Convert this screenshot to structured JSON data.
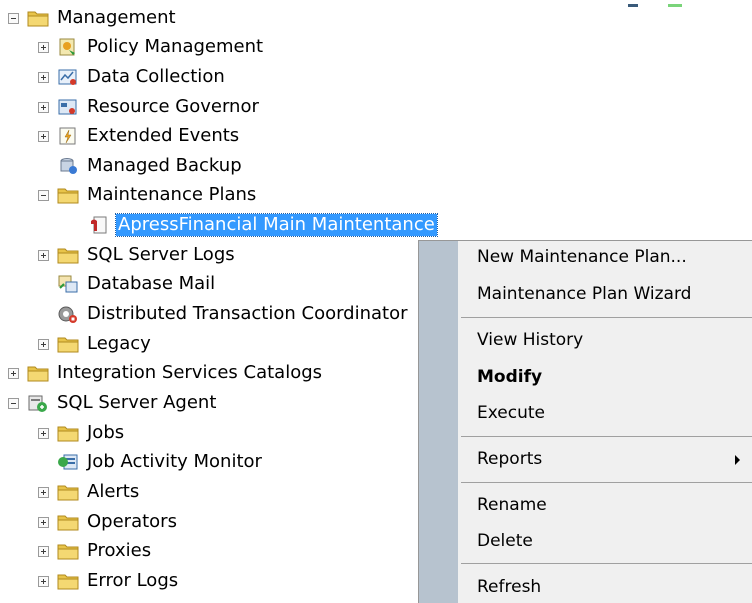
{
  "tree": {
    "management": "Management",
    "policy_management": "Policy Management",
    "data_collection": "Data Collection",
    "resource_governor": "Resource Governor",
    "extended_events": "Extended Events",
    "managed_backup": "Managed Backup",
    "maintenance_plans": "Maintenance Plans",
    "selected_plan": "ApressFinancial Main Maintentance",
    "sql_server_logs": "SQL Server Logs",
    "database_mail": "Database Mail",
    "dtc": "Distributed Transaction Coordinator",
    "legacy": "Legacy",
    "integration_services": "Integration Services Catalogs",
    "sql_server_agent": "SQL Server Agent",
    "jobs": "Jobs",
    "job_activity_monitor": "Job Activity Monitor",
    "alerts": "Alerts",
    "operators": "Operators",
    "proxies": "Proxies",
    "error_logs": "Error Logs"
  },
  "context_menu": {
    "new_plan": "New Maintenance Plan...",
    "wizard": "Maintenance Plan Wizard",
    "view_history": "View History",
    "modify": "Modify",
    "execute": "Execute",
    "reports": "Reports",
    "rename": "Rename",
    "delete": "Delete",
    "refresh": "Refresh"
  },
  "icons": {
    "folder": "folder-icon",
    "policy": "policy-management-icon",
    "data_collection": "data-collection-icon",
    "resource_governor": "resource-governor-icon",
    "extended_events": "extended-events-icon",
    "managed_backup": "managed-backup-icon",
    "plan": "maintenance-plan-icon",
    "database_mail": "database-mail-icon",
    "dtc": "dtc-icon",
    "agent": "sql-server-agent-icon",
    "job_monitor": "job-activity-monitor-icon"
  },
  "colors": {
    "selection": "#3399ff",
    "menu_gutter": "#b7c3cf",
    "menu_background": "#f0f0f0",
    "folder": "#e8c44a"
  }
}
